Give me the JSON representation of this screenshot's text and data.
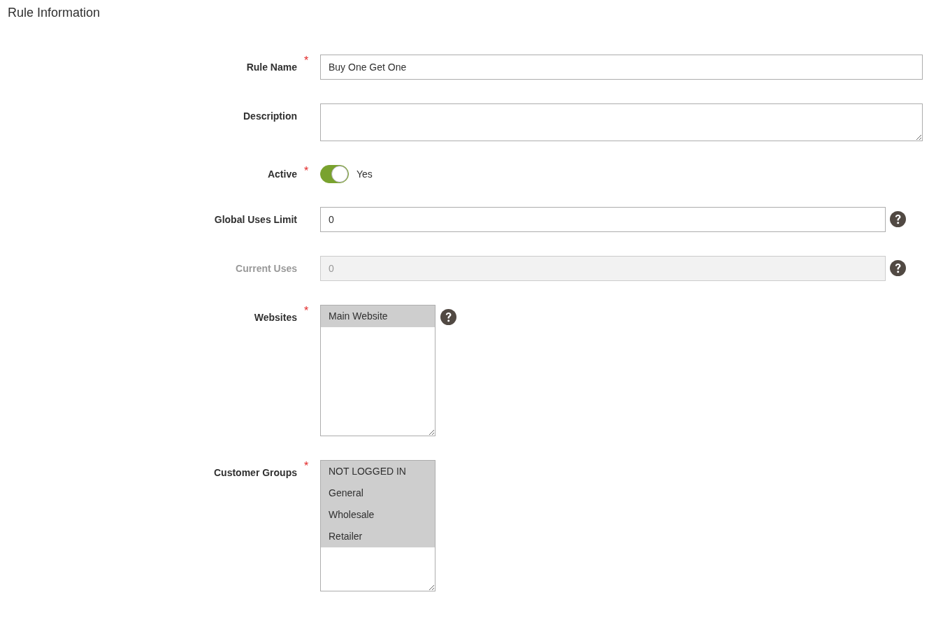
{
  "title": "Rule Information",
  "fields": [
    {
      "kind": "text",
      "label": "Rule Name",
      "required_mark": "*",
      "value": "Buy One Get One"
    },
    {
      "kind": "textarea",
      "label": "Description"
    },
    {
      "kind": "toggle",
      "label": "Active",
      "required_mark": "*",
      "on": true,
      "state_label": "Yes"
    },
    {
      "kind": "text",
      "label": "Global Uses Limit",
      "value": "0",
      "help": true
    },
    {
      "kind": "text",
      "label": "Current Uses",
      "value": "0",
      "disabled": true,
      "help": true
    },
    {
      "kind": "multiselect",
      "label": "Websites",
      "required_mark": "*",
      "help": true,
      "options": [
        {
          "label": "Main Website",
          "selected": true
        }
      ]
    },
    {
      "kind": "multiselect",
      "label": "Customer Groups",
      "required_mark": "*",
      "options": [
        {
          "label": "NOT LOGGED IN",
          "selected": true
        },
        {
          "label": "General",
          "selected": true
        },
        {
          "label": "Wholesale",
          "selected": true
        },
        {
          "label": "Retailer",
          "selected": true
        }
      ]
    }
  ]
}
